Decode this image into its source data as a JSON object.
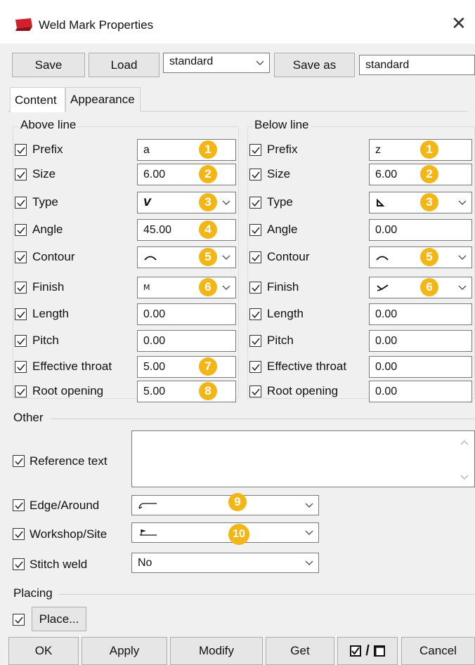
{
  "window": {
    "title": "Weld Mark Properties",
    "close_glyph": "✕"
  },
  "toolbar": {
    "save_label": "Save",
    "load_label": "Load",
    "preset_select_value": "standard",
    "save_as_label": "Save as",
    "save_as_name": "standard"
  },
  "tabs": [
    {
      "label": "Content",
      "active": true
    },
    {
      "label": "Appearance",
      "active": false
    }
  ],
  "above": {
    "group_title": "Above line",
    "rows": [
      {
        "label": "Prefix",
        "value": "a",
        "badge": "1"
      },
      {
        "label": "Size",
        "value": "6.00",
        "badge": "2"
      },
      {
        "label": "Type",
        "value": "V",
        "badge": "3"
      },
      {
        "label": "Angle",
        "value": "45.00",
        "badge": "4"
      },
      {
        "label": "Contour",
        "value": "",
        "badge": "5"
      },
      {
        "label": "Finish",
        "value": "M",
        "badge": "6"
      },
      {
        "label": "Length",
        "value": "0.00"
      },
      {
        "label": "Pitch",
        "value": "0.00"
      },
      {
        "label": "Effective throat",
        "value": "5.00",
        "badge": "7"
      },
      {
        "label": "Root opening",
        "value": "5.00",
        "badge": "8"
      }
    ]
  },
  "below": {
    "group_title": "Below line",
    "rows": [
      {
        "label": "Prefix",
        "value": "z",
        "badge": "1"
      },
      {
        "label": "Size",
        "value": "6.00",
        "badge": "2"
      },
      {
        "label": "Type",
        "value": "",
        "badge": "3"
      },
      {
        "label": "Angle",
        "value": "0.00"
      },
      {
        "label": "Contour",
        "value": "",
        "badge": "5"
      },
      {
        "label": "Finish",
        "value": "",
        "badge": "6"
      },
      {
        "label": "Length",
        "value": "0.00"
      },
      {
        "label": "Pitch",
        "value": "0.00"
      },
      {
        "label": "Effective throat",
        "value": "0.00"
      },
      {
        "label": "Root opening",
        "value": "0.00"
      }
    ]
  },
  "other": {
    "group_title": "Other",
    "reference_text_label": "Reference text",
    "reference_text_value": "",
    "edge_around_label": "Edge/Around",
    "edge_badge": "9",
    "workshop_site_label": "Workshop/Site",
    "workshop_badge": "10",
    "stitch_weld_label": "Stitch weld",
    "stitch_weld_value": "No"
  },
  "placing": {
    "group_title": "Placing",
    "place_label": "Place..."
  },
  "footer": {
    "ok_label": "OK",
    "apply_label": "Apply",
    "modify_label": "Modify",
    "get_label": "Get",
    "toggle_separator": "/",
    "cancel_label": "Cancel"
  },
  "colors": {
    "badge": "#f3b617",
    "app_icon": "#d0202a"
  }
}
